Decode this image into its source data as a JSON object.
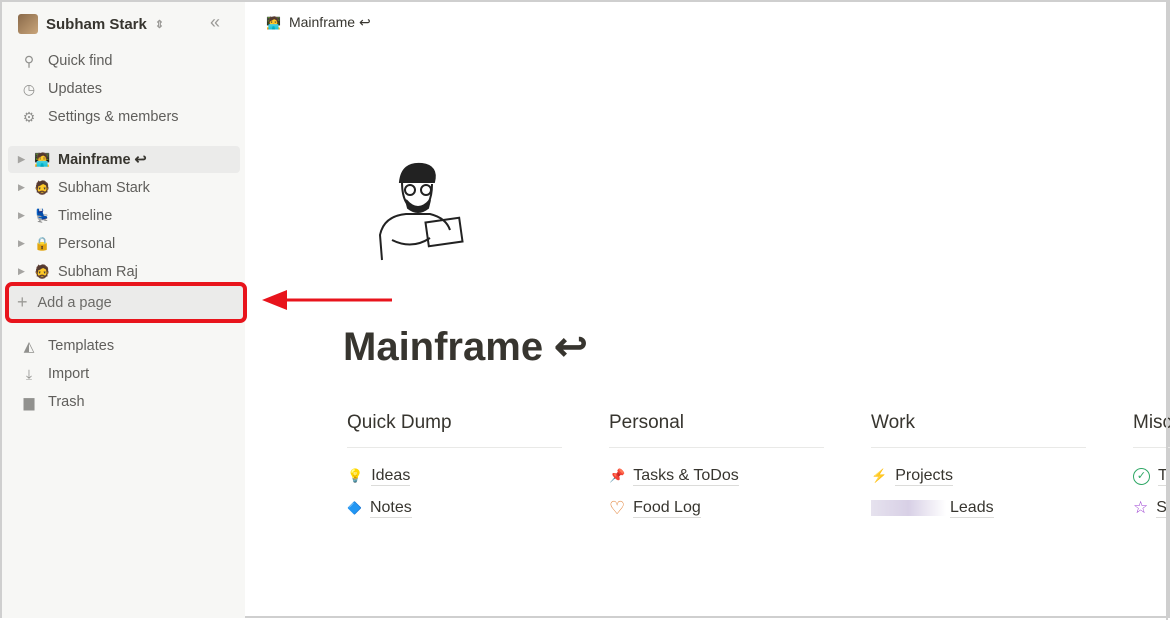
{
  "workspace": {
    "name": "Subham Stark",
    "switch_icon": "chevron-up-down-icon",
    "collapse_icon": "double-chevron-left-icon"
  },
  "nav": [
    {
      "label": "Quick find",
      "icon": "search-icon"
    },
    {
      "label": "Updates",
      "icon": "clock-icon"
    },
    {
      "label": "Settings & members",
      "icon": "gear-icon"
    }
  ],
  "pages": [
    {
      "label": "Mainframe ↩",
      "icon": "🧑‍💻"
    },
    {
      "label": "Subham Stark",
      "icon": "🧔"
    },
    {
      "label": "Timeline",
      "icon": "💺"
    },
    {
      "label": "Personal",
      "icon": "🔒"
    },
    {
      "label": "Subham Raj",
      "icon": "🧔"
    }
  ],
  "add_page": "Add a page",
  "bottom": [
    {
      "label": "Templates",
      "icon": "templates-icon"
    },
    {
      "label": "Import",
      "icon": "download-icon"
    },
    {
      "label": "Trash",
      "icon": "trash-icon"
    }
  ],
  "breadcrumb": "Mainframe ↩",
  "title": "Mainframe ↩",
  "colors": {
    "highlight": "#e8141c",
    "sidebar_bg": "#f7f7f5"
  },
  "columns": [
    {
      "heading": "Quick Dump",
      "links": [
        {
          "label": "Ideas",
          "icon": "💡"
        },
        {
          "label": "Notes",
          "icon": "🔷"
        }
      ]
    },
    {
      "heading": "Personal",
      "links": [
        {
          "label": "Tasks & ToDos",
          "icon": "📌"
        },
        {
          "label": "Food Log",
          "icon": "♡"
        }
      ]
    },
    {
      "heading": "Work",
      "links": [
        {
          "label": "Projects",
          "icon": "⚡"
        },
        {
          "label": "Leads",
          "icon": ""
        }
      ]
    },
    {
      "heading": "Misc",
      "links": [
        {
          "label": "T",
          "icon": "✓"
        },
        {
          "label": "S",
          "icon": "☆"
        }
      ]
    }
  ]
}
